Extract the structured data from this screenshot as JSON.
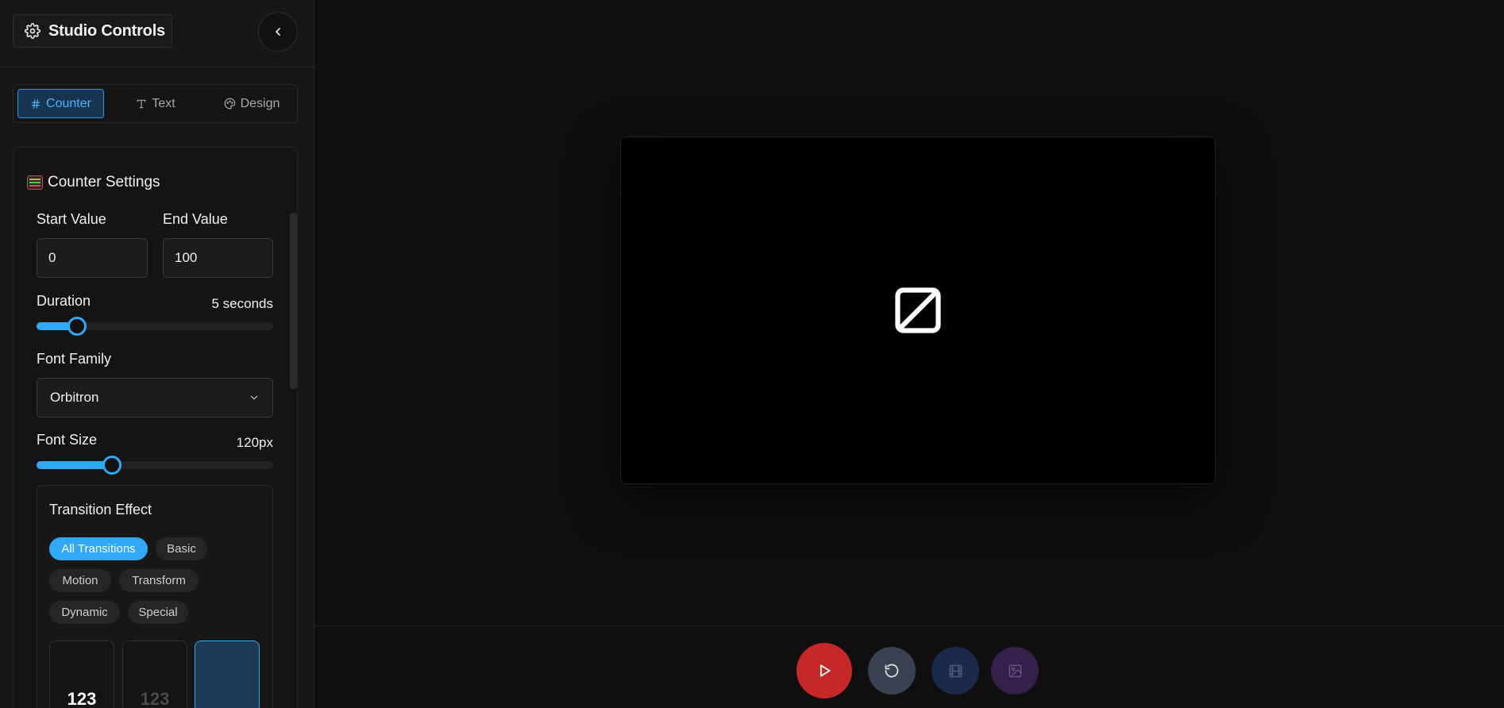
{
  "sidebar": {
    "title": "Studio Controls",
    "tabs": [
      {
        "label": "Counter",
        "icon": "hash-icon",
        "active": true
      },
      {
        "label": "Text",
        "icon": "text-icon",
        "active": false
      },
      {
        "label": "Design",
        "icon": "palette-icon",
        "active": false
      }
    ],
    "counter_settings": {
      "title": "Counter Settings",
      "start_value_label": "Start Value",
      "start_value": "0",
      "end_value_label": "End Value",
      "end_value": "100",
      "duration_label": "Duration",
      "duration_value": "5 seconds",
      "duration_fraction": 0.17,
      "font_family_label": "Font Family",
      "font_family_value": "Orbitron",
      "font_size_label": "Font Size",
      "font_size_value": "120px",
      "font_size_fraction": 0.32,
      "transition": {
        "title": "Transition Effect",
        "filters": [
          "All Transitions",
          "Basic",
          "Motion",
          "Transform",
          "Dynamic",
          "Special"
        ],
        "active_filter": "All Transitions",
        "cards": [
          {
            "label": "123",
            "color": "#ffffff"
          },
          {
            "label": "123",
            "color": "#555555"
          },
          {
            "label": "",
            "color": "#ffffff"
          }
        ]
      }
    }
  },
  "colors": {
    "accent": "#2fa9f5",
    "play": "#c62828",
    "reset": "#3a4150",
    "video": "#1b2a4a",
    "image": "#35204a"
  },
  "toolbar": {
    "buttons": [
      "play-icon",
      "reset-icon",
      "film-icon",
      "image-icon"
    ]
  }
}
